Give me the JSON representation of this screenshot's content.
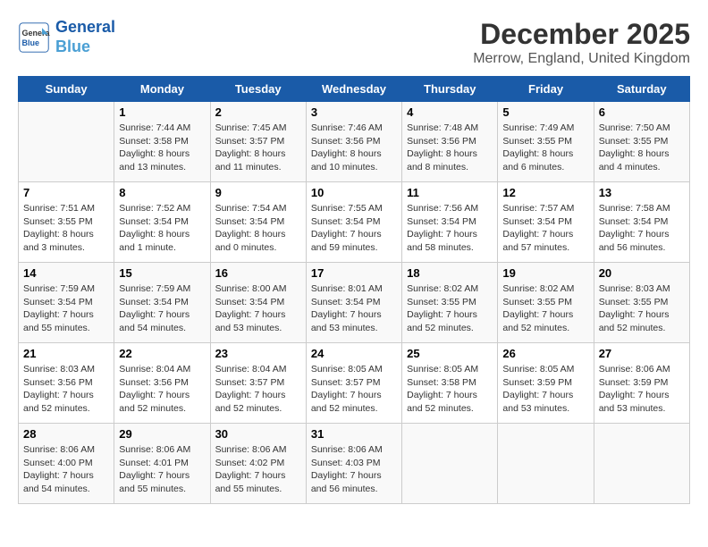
{
  "header": {
    "logo_line1": "General",
    "logo_line2": "Blue",
    "month": "December 2025",
    "location": "Merrow, England, United Kingdom"
  },
  "weekdays": [
    "Sunday",
    "Monday",
    "Tuesday",
    "Wednesday",
    "Thursday",
    "Friday",
    "Saturday"
  ],
  "weeks": [
    [
      {
        "day": "",
        "sunrise": "",
        "sunset": "",
        "daylight": ""
      },
      {
        "day": "1",
        "sunrise": "Sunrise: 7:44 AM",
        "sunset": "Sunset: 3:58 PM",
        "daylight": "Daylight: 8 hours and 13 minutes."
      },
      {
        "day": "2",
        "sunrise": "Sunrise: 7:45 AM",
        "sunset": "Sunset: 3:57 PM",
        "daylight": "Daylight: 8 hours and 11 minutes."
      },
      {
        "day": "3",
        "sunrise": "Sunrise: 7:46 AM",
        "sunset": "Sunset: 3:56 PM",
        "daylight": "Daylight: 8 hours and 10 minutes."
      },
      {
        "day": "4",
        "sunrise": "Sunrise: 7:48 AM",
        "sunset": "Sunset: 3:56 PM",
        "daylight": "Daylight: 8 hours and 8 minutes."
      },
      {
        "day": "5",
        "sunrise": "Sunrise: 7:49 AM",
        "sunset": "Sunset: 3:55 PM",
        "daylight": "Daylight: 8 hours and 6 minutes."
      },
      {
        "day": "6",
        "sunrise": "Sunrise: 7:50 AM",
        "sunset": "Sunset: 3:55 PM",
        "daylight": "Daylight: 8 hours and 4 minutes."
      }
    ],
    [
      {
        "day": "7",
        "sunrise": "Sunrise: 7:51 AM",
        "sunset": "Sunset: 3:55 PM",
        "daylight": "Daylight: 8 hours and 3 minutes."
      },
      {
        "day": "8",
        "sunrise": "Sunrise: 7:52 AM",
        "sunset": "Sunset: 3:54 PM",
        "daylight": "Daylight: 8 hours and 1 minute."
      },
      {
        "day": "9",
        "sunrise": "Sunrise: 7:54 AM",
        "sunset": "Sunset: 3:54 PM",
        "daylight": "Daylight: 8 hours and 0 minutes."
      },
      {
        "day": "10",
        "sunrise": "Sunrise: 7:55 AM",
        "sunset": "Sunset: 3:54 PM",
        "daylight": "Daylight: 7 hours and 59 minutes."
      },
      {
        "day": "11",
        "sunrise": "Sunrise: 7:56 AM",
        "sunset": "Sunset: 3:54 PM",
        "daylight": "Daylight: 7 hours and 58 minutes."
      },
      {
        "day": "12",
        "sunrise": "Sunrise: 7:57 AM",
        "sunset": "Sunset: 3:54 PM",
        "daylight": "Daylight: 7 hours and 57 minutes."
      },
      {
        "day": "13",
        "sunrise": "Sunrise: 7:58 AM",
        "sunset": "Sunset: 3:54 PM",
        "daylight": "Daylight: 7 hours and 56 minutes."
      }
    ],
    [
      {
        "day": "14",
        "sunrise": "Sunrise: 7:59 AM",
        "sunset": "Sunset: 3:54 PM",
        "daylight": "Daylight: 7 hours and 55 minutes."
      },
      {
        "day": "15",
        "sunrise": "Sunrise: 7:59 AM",
        "sunset": "Sunset: 3:54 PM",
        "daylight": "Daylight: 7 hours and 54 minutes."
      },
      {
        "day": "16",
        "sunrise": "Sunrise: 8:00 AM",
        "sunset": "Sunset: 3:54 PM",
        "daylight": "Daylight: 7 hours and 53 minutes."
      },
      {
        "day": "17",
        "sunrise": "Sunrise: 8:01 AM",
        "sunset": "Sunset: 3:54 PM",
        "daylight": "Daylight: 7 hours and 53 minutes."
      },
      {
        "day": "18",
        "sunrise": "Sunrise: 8:02 AM",
        "sunset": "Sunset: 3:55 PM",
        "daylight": "Daylight: 7 hours and 52 minutes."
      },
      {
        "day": "19",
        "sunrise": "Sunrise: 8:02 AM",
        "sunset": "Sunset: 3:55 PM",
        "daylight": "Daylight: 7 hours and 52 minutes."
      },
      {
        "day": "20",
        "sunrise": "Sunrise: 8:03 AM",
        "sunset": "Sunset: 3:55 PM",
        "daylight": "Daylight: 7 hours and 52 minutes."
      }
    ],
    [
      {
        "day": "21",
        "sunrise": "Sunrise: 8:03 AM",
        "sunset": "Sunset: 3:56 PM",
        "daylight": "Daylight: 7 hours and 52 minutes."
      },
      {
        "day": "22",
        "sunrise": "Sunrise: 8:04 AM",
        "sunset": "Sunset: 3:56 PM",
        "daylight": "Daylight: 7 hours and 52 minutes."
      },
      {
        "day": "23",
        "sunrise": "Sunrise: 8:04 AM",
        "sunset": "Sunset: 3:57 PM",
        "daylight": "Daylight: 7 hours and 52 minutes."
      },
      {
        "day": "24",
        "sunrise": "Sunrise: 8:05 AM",
        "sunset": "Sunset: 3:57 PM",
        "daylight": "Daylight: 7 hours and 52 minutes."
      },
      {
        "day": "25",
        "sunrise": "Sunrise: 8:05 AM",
        "sunset": "Sunset: 3:58 PM",
        "daylight": "Daylight: 7 hours and 52 minutes."
      },
      {
        "day": "26",
        "sunrise": "Sunrise: 8:05 AM",
        "sunset": "Sunset: 3:59 PM",
        "daylight": "Daylight: 7 hours and 53 minutes."
      },
      {
        "day": "27",
        "sunrise": "Sunrise: 8:06 AM",
        "sunset": "Sunset: 3:59 PM",
        "daylight": "Daylight: 7 hours and 53 minutes."
      }
    ],
    [
      {
        "day": "28",
        "sunrise": "Sunrise: 8:06 AM",
        "sunset": "Sunset: 4:00 PM",
        "daylight": "Daylight: 7 hours and 54 minutes."
      },
      {
        "day": "29",
        "sunrise": "Sunrise: 8:06 AM",
        "sunset": "Sunset: 4:01 PM",
        "daylight": "Daylight: 7 hours and 55 minutes."
      },
      {
        "day": "30",
        "sunrise": "Sunrise: 8:06 AM",
        "sunset": "Sunset: 4:02 PM",
        "daylight": "Daylight: 7 hours and 55 minutes."
      },
      {
        "day": "31",
        "sunrise": "Sunrise: 8:06 AM",
        "sunset": "Sunset: 4:03 PM",
        "daylight": "Daylight: 7 hours and 56 minutes."
      },
      {
        "day": "",
        "sunrise": "",
        "sunset": "",
        "daylight": ""
      },
      {
        "day": "",
        "sunrise": "",
        "sunset": "",
        "daylight": ""
      },
      {
        "day": "",
        "sunrise": "",
        "sunset": "",
        "daylight": ""
      }
    ]
  ]
}
